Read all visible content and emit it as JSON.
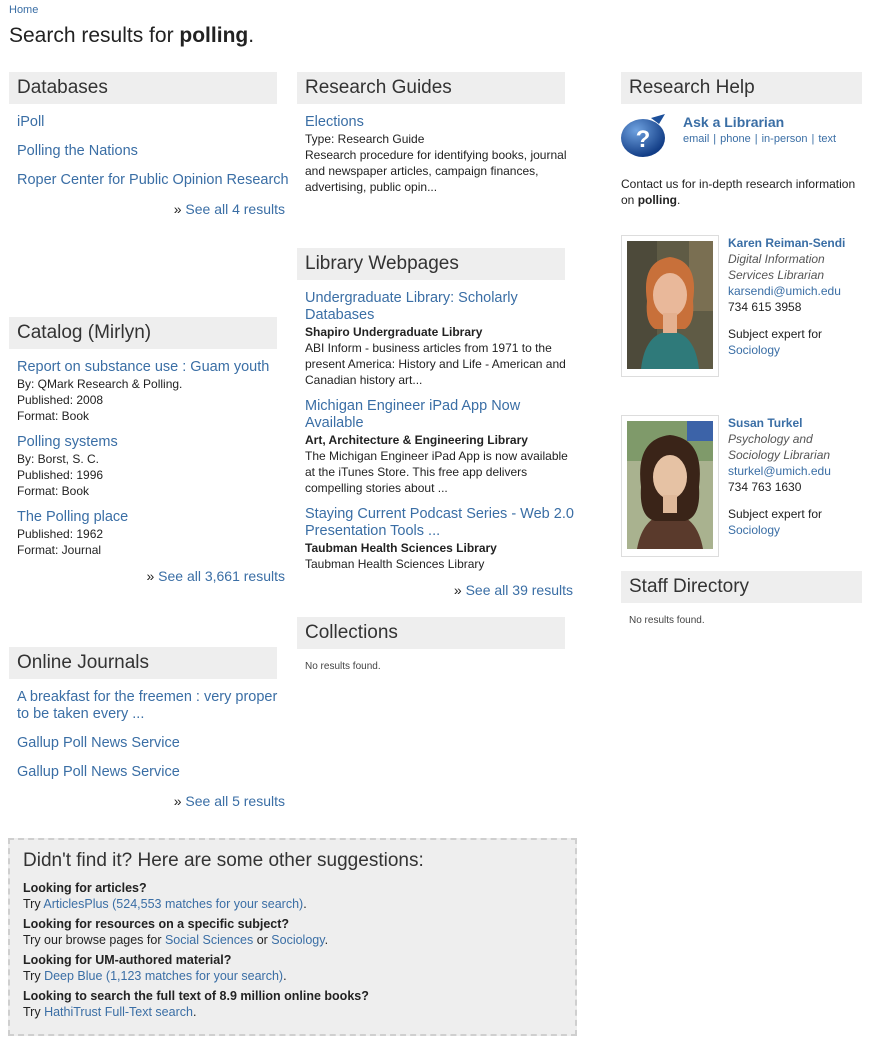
{
  "breadcrumb": {
    "home": "Home"
  },
  "title": {
    "prefix": "Search results for ",
    "query": "polling",
    "suffix": "."
  },
  "databases": {
    "heading": "Databases",
    "items": [
      "iPoll",
      "Polling the Nations",
      "Roper Center for Public Opinion Research"
    ],
    "see_all": "See all 4 results"
  },
  "catalog": {
    "heading": "Catalog (Mirlyn)",
    "items": [
      {
        "title": "Report on substance use : Guam youth",
        "by": "By: QMark Research & Polling.",
        "published": "Published: 2008",
        "format": "Format: Book"
      },
      {
        "title": "Polling systems",
        "by": "By: Borst, S. C.",
        "published": "Published: 1996",
        "format": "Format: Book"
      },
      {
        "title": "The Polling place",
        "published": "Published: 1962",
        "format": "Format: Journal"
      }
    ],
    "see_all": "See all 3,661 results"
  },
  "journals": {
    "heading": "Online Journals",
    "items": [
      "A breakfast for the freemen : very proper to be taken every ...",
      "Gallup Poll News Service",
      "Gallup Poll News Service"
    ],
    "see_all": "See all 5 results"
  },
  "guides": {
    "heading": "Research Guides",
    "items": [
      {
        "title": "Elections",
        "type": "Type: Research Guide",
        "desc": "Research procedure for identifying books, journal and newspaper articles, campaign finances, advertising, public opin..."
      }
    ]
  },
  "webpages": {
    "heading": "Library Webpages",
    "items": [
      {
        "title": "Undergraduate Library: Scholarly Databases",
        "library": "Shapiro Undergraduate Library",
        "desc": "ABI Inform - business articles from 1971 to the present America: History and Life - American and Canadian history art..."
      },
      {
        "title": "Michigan Engineer iPad App Now Available",
        "library": "Art, Architecture & Engineering Library",
        "desc": "The Michigan Engineer iPad App is now available at the iTunes Store. This free app delivers compelling stories about ..."
      },
      {
        "title": "Staying Current Podcast Series - Web 2.0 Presentation Tools ...",
        "library": "Taubman Health Sciences Library",
        "desc": "Taubman Health Sciences Library"
      }
    ],
    "see_all": "See all 39 results"
  },
  "collections": {
    "heading": "Collections",
    "empty": "No results found."
  },
  "research_help": {
    "heading": "Research Help",
    "ask_title": "Ask a Librarian",
    "ask_links": [
      "email",
      "phone",
      "in-person",
      "text"
    ],
    "ask_separator": "|",
    "contact_prefix": "Contact us for in-depth research information on ",
    "contact_query": "polling",
    "contact_suffix": ".",
    "staff": [
      {
        "name": "Karen Reiman-Sendi",
        "title": "Digital Information Services Librarian",
        "email": "karsendi@umich.edu",
        "phone": "734 615 3958",
        "expert_label": "Subject expert for",
        "subject": "Sociology"
      },
      {
        "name": "Susan Turkel",
        "title": "Psychology and Sociology Librarian",
        "email": "sturkel@umich.edu",
        "phone": "734 763 1630",
        "expert_label": "Subject expert for",
        "subject": "Sociology"
      }
    ]
  },
  "staff_directory": {
    "heading": "Staff Directory",
    "empty": "No results found."
  },
  "suggestions": {
    "heading": "Didn't find it? Here are some other suggestions:",
    "items": [
      {
        "question": "Looking for articles?",
        "prefix": "Try ",
        "link": "ArticlesPlus (524,553 matches for your search)",
        "suffix": "."
      },
      {
        "question": "Looking for resources on a specific subject?",
        "prefix": "Try our browse pages for ",
        "link": "Social Sciences",
        "middle": " or ",
        "link2": "Sociology",
        "suffix": "."
      },
      {
        "question": "Looking for UM-authored material?",
        "prefix": "Try ",
        "link": "Deep Blue (1,123 matches for your search)",
        "suffix": "."
      },
      {
        "question": "Looking to search the full text of 8.9 million online books?",
        "prefix": "Try ",
        "link": "HathiTrust Full-Text search",
        "suffix": "."
      }
    ]
  },
  "colors": {
    "link": "#3a6ea5",
    "section_bg": "#eeeeee",
    "text": "#222222"
  }
}
